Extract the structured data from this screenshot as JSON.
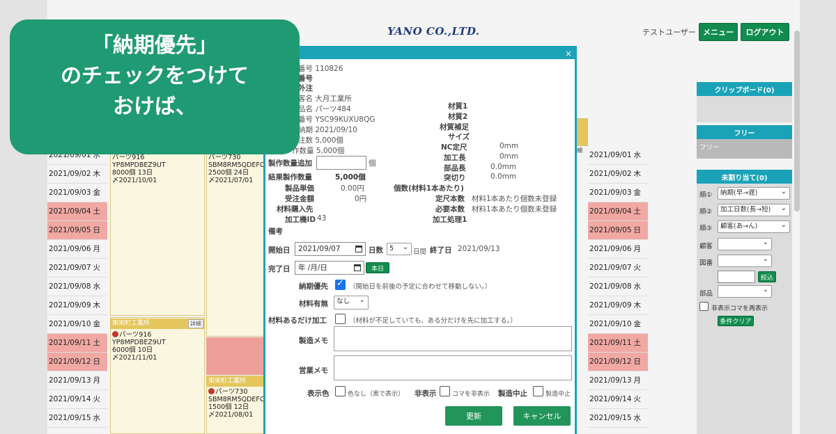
{
  "header": {
    "logo": "YANO CO.,LTD.",
    "user": "テストユーザー",
    "menu_label": "メニュー",
    "logout_label": "ログアウト"
  },
  "calendar": [
    {
      "date": "2021/09/01",
      "dow": "水",
      "holiday": false
    },
    {
      "date": "2021/09/02",
      "dow": "木",
      "holiday": false
    },
    {
      "date": "2021/09/03",
      "dow": "金",
      "holiday": false
    },
    {
      "date": "2021/09/04",
      "dow": "土",
      "holiday": true
    },
    {
      "date": "2021/09/05",
      "dow": "日",
      "holiday": true
    },
    {
      "date": "2021/09/06",
      "dow": "月",
      "holiday": false
    },
    {
      "date": "2021/09/07",
      "dow": "火",
      "holiday": false
    },
    {
      "date": "2021/09/08",
      "dow": "水",
      "holiday": false
    },
    {
      "date": "2021/09/09",
      "dow": "木",
      "holiday": false
    },
    {
      "date": "2021/09/10",
      "dow": "金",
      "holiday": false
    },
    {
      "date": "2021/09/11",
      "dow": "土",
      "holiday": true
    },
    {
      "date": "2021/09/12",
      "dow": "日",
      "holiday": true
    },
    {
      "date": "2021/09/13",
      "dow": "月",
      "holiday": false
    },
    {
      "date": "2021/09/14",
      "dow": "火",
      "holiday": false
    },
    {
      "date": "2021/09/15",
      "dow": "水",
      "holiday": false
    }
  ],
  "cards": {
    "c1": {
      "lines": [
        "パーツ916",
        "YP8MPDBEZ9UT",
        "8000個 13日",
        "〆2021/10/01"
      ]
    },
    "c2": {
      "lines": [
        "パーツ730",
        "SBM8RM5QDEFC",
        "2500個 24日",
        "〆2021/07/01"
      ]
    },
    "c3": {
      "company": "東栄町工業所",
      "detail": "詳細",
      "lines": [
        "パーツ916",
        "YP8MPDBEZ9UT",
        "6000個 10日",
        "〆2021/11/01"
      ]
    },
    "c4": {
      "company": "東栄町工業所",
      "lines": [
        "パーツ730",
        "SBM8RM5QDEFC",
        "1500個 12日",
        "〆2021/08/01"
      ]
    },
    "detail_small": "細"
  },
  "sidebar": {
    "clipboard": "クリップボード(0)",
    "free_header": "フリー",
    "free_item": "フリー",
    "unassigned": "未割り当て(0)",
    "sort1_label": "順①",
    "sort1_value": "納期(早→遅)",
    "sort2_label": "順②",
    "sort2_value": "加工日数(長→短)",
    "sort3_label": "順③",
    "sort3_value": "顧客(あ→ん)",
    "customer_label": "顧客",
    "drawing_label": "図番",
    "narrow_label": "絞込",
    "part_label": "部品",
    "show_hidden": "非表示コマを再表示",
    "clear": "条件クリア"
  },
  "modal": {
    "close": "×",
    "order_no": "番号 110826",
    "row_number": "番号",
    "outsource": "外注",
    "customer": "客名 大月工業所",
    "product": "品名 パーツ484",
    "drawing": "番号 YSC99KUXU8QG",
    "due": "納期 2021/09/10",
    "order_qty": "注数 5,000個",
    "prod_qty": "作数量 5,000個",
    "add_qty_label": "製作数量追加",
    "add_qty_unit": "個",
    "result_qty_label": "結果製作数量",
    "result_qty": "5,000個",
    "unit_price_label": "製品単価",
    "unit_price": "0.00円",
    "amount_label": "受注金額",
    "amount": "0円",
    "material_buyer_label": "材料購入先",
    "machine_label": "加工機ID",
    "machine": "43",
    "mat1_label": "材質1",
    "mat2_label": "材質2",
    "mat_supp_label": "材質補足",
    "size_label": "サイズ",
    "nc_label": "NC定尺",
    "nc": "0mm",
    "proc_len_label": "加工長",
    "proc_len": "0mm",
    "part_len_label": "部品長",
    "part_len": "0.0mm",
    "cut_label": "突切り",
    "cut": "0.0mm",
    "pcs_label": "個数(材料1本あたり)",
    "std_qty_label": "定尺本数",
    "std_qty": "材料1本あたり個数未登録",
    "need_qty_label": "必要本数",
    "need_qty": "材料1本あたり個数未登録",
    "proc_label": "加工処理1",
    "memo_label": "備考",
    "start_label": "開始日",
    "start_value": "2021/09/07",
    "days_label": "日数",
    "days_value": "5",
    "days_unit": "日間",
    "end_label": "終了日",
    "end_value": "2021/09/13",
    "finish_label": "完了日",
    "finish_value": "年 /月/日",
    "today": "本日",
    "priority_label": "納期優先",
    "priority_note": "（開始日を前後の予定に合わせて移動しない。）",
    "material_label": "材料有無",
    "material_value": "なし",
    "partial_label": "材料あるだけ加工",
    "partial_note": "（材料が不足していても、ある分だけを先に加工する。）",
    "mfg_memo": "製造メモ",
    "sales_memo": "営業メモ",
    "color_label": "表示色",
    "color_note": "色なし（黒で表示）",
    "hide_label": "非表示",
    "hide_note": "コマを非表示",
    "stop_label": "製造中止",
    "stop_note": "製造中止",
    "update": "更新",
    "cancel": "キャンセル"
  },
  "overlay": {
    "line1": "「納期優先」",
    "line2": "のチェックをつけて",
    "line3": "おけば、"
  }
}
